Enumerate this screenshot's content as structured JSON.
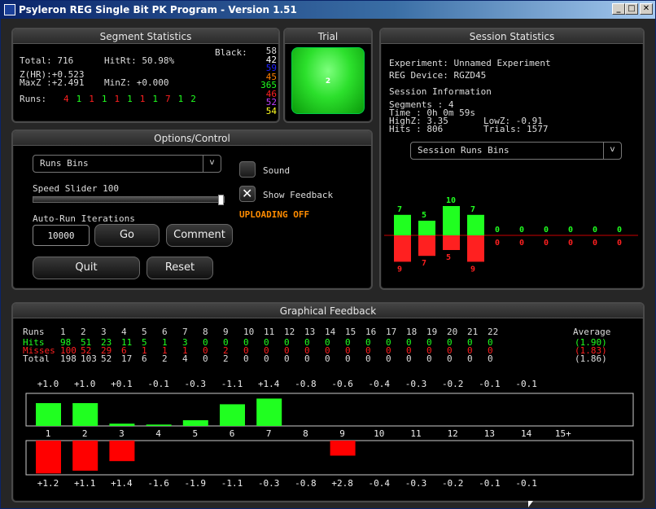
{
  "window": {
    "title": "Psyleron REG Single Bit PK Program - Version 1.51"
  },
  "segment": {
    "title": "Segment Statistics",
    "black_label": "Black:",
    "total": "Total: 716",
    "hitrt": "HitRt: 50.98%",
    "zhr": "Z(HR):+0.523",
    "maxz": "MaxZ :+2.491",
    "minz": "MinZ: +0.000",
    "runs_label": "Runs:",
    "runs": [
      {
        "v": "4",
        "c": "#ff2020"
      },
      {
        "v": "1",
        "c": "#20ff20"
      },
      {
        "v": "1",
        "c": "#ff2020"
      },
      {
        "v": "1",
        "c": "#20ff20"
      },
      {
        "v": "1",
        "c": "#ff2020"
      },
      {
        "v": "1",
        "c": "#20ff20"
      },
      {
        "v": "1",
        "c": "#ff2020"
      },
      {
        "v": "1",
        "c": "#20ff20"
      },
      {
        "v": "7",
        "c": "#ff2020"
      },
      {
        "v": "1",
        "c": "#20ff20"
      },
      {
        "v": "2",
        "c": "#20ff20"
      }
    ],
    "colors": [
      {
        "v": "58",
        "c": "#dddddd"
      },
      {
        "v": "42",
        "c": "#ffffff"
      },
      {
        "v": "59",
        "c": "#2020ff"
      },
      {
        "v": "45",
        "c": "#ff8000"
      },
      {
        "v": "365",
        "c": "#20ff20"
      },
      {
        "v": "46",
        "c": "#ff2020"
      },
      {
        "v": "52",
        "c": "#c040ff"
      },
      {
        "v": "54",
        "c": "#ffff20"
      }
    ]
  },
  "trial": {
    "title": "Trial",
    "value": "2"
  },
  "session": {
    "title": "Session Statistics",
    "experiment": "Experiment: Unnamed Experiment",
    "device": "REG Device: RGZD45",
    "info": "Session Information",
    "segments": "Segments : 4",
    "time": "Time : 0h 0m 59s",
    "highz": "HighZ: 3.35",
    "lowz": "LowZ: -0.91",
    "hits": "Hits : 806",
    "trials": "Trials: 1577",
    "dropdown": "Session Runs Bins",
    "bins_hits": [
      "7",
      "5",
      "10",
      "7",
      "0",
      "0",
      "0",
      "0",
      "0",
      "0"
    ],
    "bins_hits_val": [
      7,
      5,
      10,
      7,
      0,
      0,
      0,
      0,
      0,
      0
    ],
    "bins_miss": [
      "9",
      "7",
      "5",
      "9",
      "0",
      "0",
      "0",
      "0",
      "0",
      "0"
    ],
    "bins_miss_val": [
      9,
      7,
      5,
      9,
      0,
      0,
      0,
      0,
      0,
      0
    ]
  },
  "options": {
    "title": "Options/Control",
    "dropdown": "Runs Bins",
    "speed": "Speed Slider 100",
    "speed_value": 1.0,
    "sound": "Sound",
    "show_feedback": "Show Feedback",
    "uploading": "UPLOADING OFF",
    "auto_run": "Auto-Run Iterations",
    "iterations": "10000",
    "go": "Go",
    "comment": "Comment",
    "quit": "Quit",
    "reset": "Reset"
  },
  "graphical": {
    "title": "Graphical Feedback",
    "row_runs": "Runs",
    "row_hits": "Hits",
    "row_misses": "Misses",
    "row_total": "Total",
    "average_label": "Average",
    "runs": [
      "1",
      "2",
      "3",
      "4",
      "5",
      "6",
      "7",
      "8",
      "9",
      "10",
      "11",
      "12",
      "13",
      "14",
      "15",
      "16",
      "17",
      "18",
      "19",
      "20",
      "21",
      "22"
    ],
    "hits": [
      "98",
      "51",
      "23",
      "11",
      "5",
      "1",
      "3",
      "0",
      "0",
      "0",
      "0",
      "0",
      "0",
      "0",
      "0",
      "0",
      "0",
      "0",
      "0",
      "0",
      "0",
      "0"
    ],
    "misses": [
      "100",
      "52",
      "29",
      "6",
      "1",
      "1",
      "1",
      "0",
      "2",
      "0",
      "0",
      "0",
      "0",
      "0",
      "0",
      "0",
      "0",
      "0",
      "0",
      "0",
      "0",
      "0"
    ],
    "totals": [
      "198",
      "103",
      "52",
      "17",
      "6",
      "2",
      "4",
      "0",
      "2",
      "0",
      "0",
      "0",
      "0",
      "0",
      "0",
      "0",
      "0",
      "0",
      "0",
      "0",
      "0",
      "0"
    ],
    "avg_hits": "(1.90)",
    "avg_misses": "(1.83)",
    "avg_total": "(1.86)",
    "top_z": [
      "+1.0",
      "+1.0",
      "+0.1",
      "-0.1",
      "-0.3",
      "-1.1",
      "+1.4",
      "-0.8",
      "-0.6",
      "-0.4",
      "-0.3",
      "-0.2",
      "-0.1",
      "-0.1"
    ],
    "bot_z": [
      "+1.2",
      "+1.1",
      "+1.4",
      "-1.6",
      "-1.9",
      "-1.1",
      "-0.3",
      "-0.8",
      "+2.8",
      "-0.4",
      "-0.3",
      "-0.2",
      "-0.1",
      "-0.1"
    ],
    "bins": [
      "1",
      "2",
      "3",
      "4",
      "5",
      "6",
      "7",
      "8",
      "9",
      "10",
      "11",
      "12",
      "13",
      "14",
      "15+"
    ],
    "top_bars": [
      1.0,
      1.0,
      0.1,
      0.06,
      0.25,
      0.95,
      1.2,
      0,
      0,
      0,
      0,
      0,
      0,
      0
    ],
    "bot_bars": [
      1.2,
      1.1,
      0.75,
      0,
      0,
      0,
      0,
      0,
      0.55,
      0,
      0,
      0,
      0,
      0
    ]
  }
}
